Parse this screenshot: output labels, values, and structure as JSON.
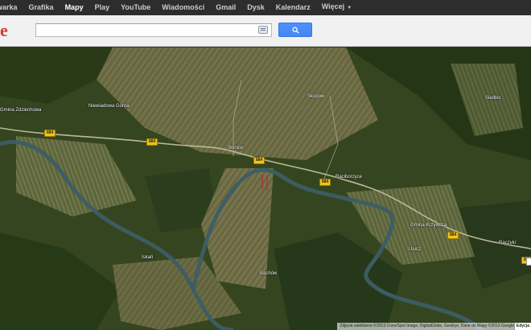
{
  "nav": {
    "items": [
      {
        "label": "warka",
        "active": false
      },
      {
        "label": "Grafika",
        "active": false
      },
      {
        "label": "Mapy",
        "active": true
      },
      {
        "label": "Play",
        "active": false
      },
      {
        "label": "YouTube",
        "active": false
      },
      {
        "label": "Wiadomości",
        "active": false
      },
      {
        "label": "Gmail",
        "active": false
      },
      {
        "label": "Dysk",
        "active": false
      },
      {
        "label": "Kalendarz",
        "active": false
      },
      {
        "label": "Więcej",
        "active": false
      }
    ]
  },
  "header": {
    "logo_text": "e",
    "search_value": "",
    "search_button_icon": "search-icon",
    "keyboard_icon": "keyboard-icon"
  },
  "map": {
    "places": [
      "Gmina Zdziechowa",
      "Niewiadowa Górna",
      "Skopów",
      "Siedlec",
      "Bonice",
      "Raciborzyce",
      "Gmina Krzywcza",
      "Ulucz",
      "Iskań",
      "Bachów",
      "Rączyki"
    ],
    "road_shields": [
      "884",
      "884",
      "884",
      "884",
      "884",
      "884"
    ],
    "attribution": "Zdjęcia satelitarne ©2013 Cnes/Spot Image, DigitalGlobe, GeoEye, Dane do Mapy ©2013 Google",
    "edit_label": "Edycja",
    "colors": {
      "river": "#3d5d66",
      "road": "#c9c4a8",
      "forest": "#263a1a",
      "fields": "#6b6a45"
    }
  }
}
